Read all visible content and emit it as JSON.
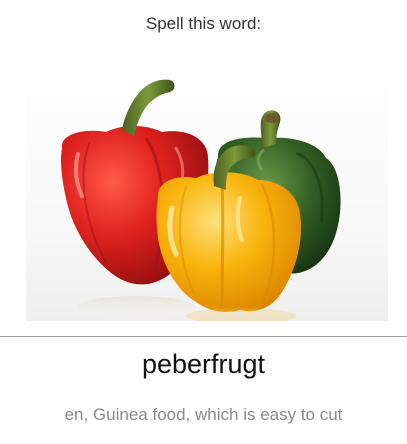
{
  "prompt": {
    "label": "Spell this word:"
  },
  "image": {
    "subject": "red-green-yellow-peppers",
    "colors": {
      "red_pepper": "#d71f1c",
      "green_pepper": "#2f5a22",
      "yellow_pepper": "#f6b00b",
      "stem": "#5f7a2c"
    }
  },
  "answer": {
    "word": "peberfrugt"
  },
  "hint": {
    "text": "en, Guinea food, which is easy to cut"
  }
}
